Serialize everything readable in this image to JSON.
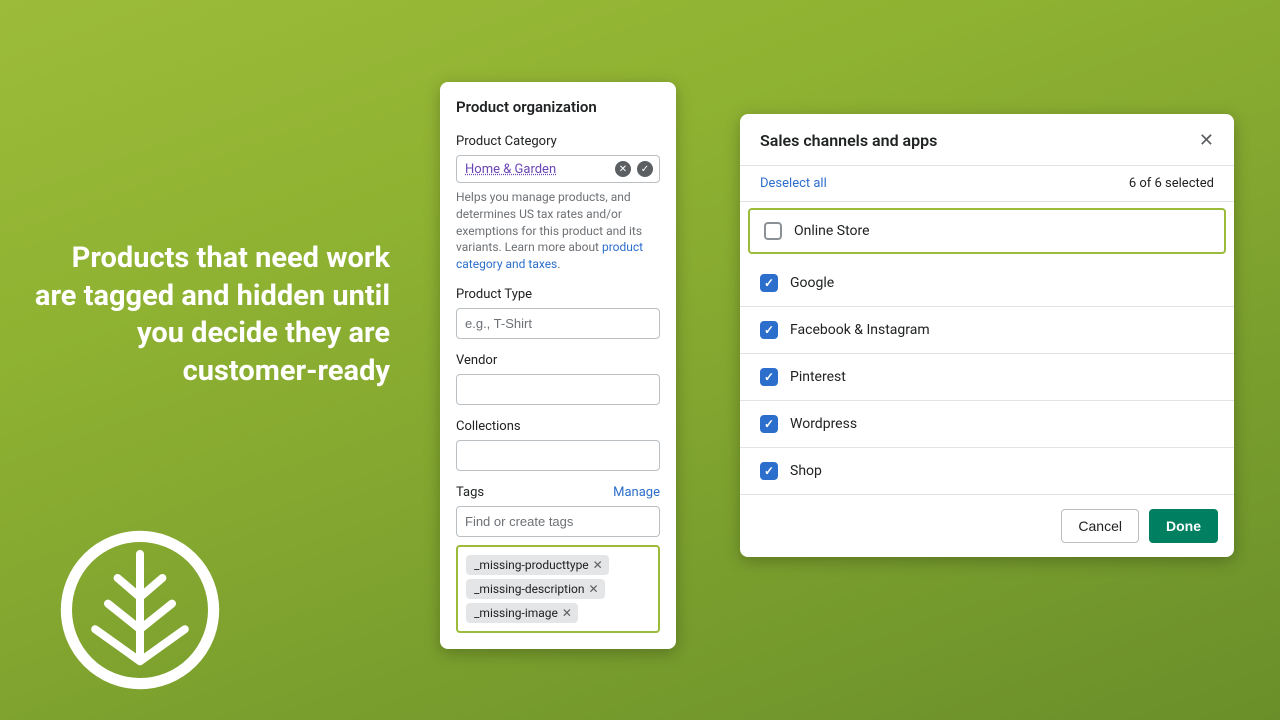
{
  "headline": "Products that need work are tagged and hidden until you decide they are customer-ready",
  "leftCard": {
    "title": "Product organization",
    "category": {
      "label": "Product Category",
      "value": "Home & Garden",
      "help": "Helps you manage products, and determines US tax rates and/or exemptions for this product and its variants. Learn more about ",
      "helpLink": "product category and taxes"
    },
    "type": {
      "label": "Product Type",
      "placeholder": "e.g., T-Shirt"
    },
    "vendor": {
      "label": "Vendor"
    },
    "collections": {
      "label": "Collections"
    },
    "tags": {
      "label": "Tags",
      "manage": "Manage",
      "placeholder": "Find or create tags",
      "items": [
        "_missing-producttype",
        "_missing-description",
        "_missing-image"
      ]
    }
  },
  "rightCard": {
    "title": "Sales channels and apps",
    "deselect": "Deselect all",
    "count": "6 of 6 selected",
    "channels": [
      {
        "name": "Online Store",
        "checked": false,
        "highlight": true
      },
      {
        "name": "Google",
        "checked": true
      },
      {
        "name": "Facebook & Instagram",
        "checked": true
      },
      {
        "name": "Pinterest",
        "checked": true
      },
      {
        "name": "Wordpress",
        "checked": true
      },
      {
        "name": "Shop",
        "checked": true
      }
    ],
    "cancel": "Cancel",
    "done": "Done"
  }
}
